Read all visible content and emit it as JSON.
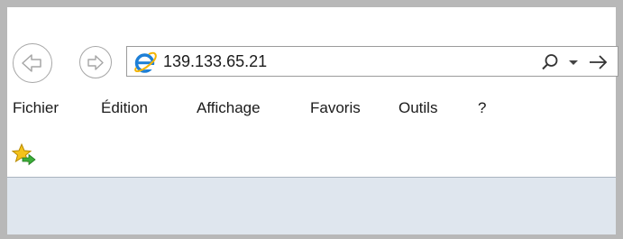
{
  "address_bar": {
    "url": "139.133.65.21",
    "site_icon": "ie-e-icon",
    "search_icon": "search-icon",
    "dropdown_icon": "dropdown-arrow-icon",
    "go_icon": "go-arrow-icon"
  },
  "navigation": {
    "back_icon": "back-arrow-icon",
    "forward_icon": "forward-arrow-icon"
  },
  "menu": {
    "items": [
      "Fichier",
      "Édition",
      "Affichage",
      "Favoris",
      "Outils",
      "?"
    ]
  },
  "favorites_bar": {
    "icon": "add-favorite-icon"
  },
  "colors": {
    "frame": "#b8b8b8",
    "content_background": "#dfe6ee",
    "ie_blue": "#1e7fd6",
    "star_yellow": "#f4c21b",
    "arrow_green": "#3dae3a"
  }
}
